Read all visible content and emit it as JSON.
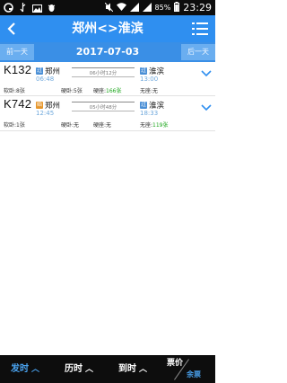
{
  "status_bar": {
    "battery": "85%",
    "time": "23:29"
  },
  "header": {
    "title": "郑州<>淮滨"
  },
  "date_bar": {
    "prev_label": "前一天",
    "date": "2017-07-03",
    "next_label": "后一天"
  },
  "trains": [
    {
      "number": "K132",
      "from_tag": "过",
      "from_station": "郑州",
      "depart_time": "06:48",
      "duration": "06小时12分",
      "to_tag": "过",
      "to_station": "淮滨",
      "arrive_time": "13:00",
      "seat_soft_sleeper": "软卧:8张",
      "seat_hard_sleeper": "硬卧:5张",
      "seat_hard_seat_label": "硬座:",
      "seat_hard_seat_count": "166张",
      "seat_no_seat": "无座:无"
    },
    {
      "number": "K742",
      "from_tag": "始",
      "from_station": "郑州",
      "depart_time": "12:45",
      "duration": "05小时48分",
      "to_tag": "过",
      "to_station": "淮滨",
      "arrive_time": "18:33",
      "seat_soft_sleeper": "软卧:1张",
      "seat_hard_sleeper": "硬卧:无",
      "seat_hard_seat_label": "硬座:无",
      "seat_hard_seat_count": "",
      "seat_no_seat_label": "无座:",
      "seat_no_seat_count": "119张"
    }
  ],
  "bottom_bar": {
    "depart_label": "发时",
    "duration_label": "历时",
    "arrive_label": "到时",
    "price_label": "票价",
    "remaining_label": "余票"
  },
  "colors": {
    "header_bg": "#2f8ff0",
    "date_bar_bg": "#3a8fe6",
    "active_sort": "#4aa3f0",
    "seat_available": "#1aa51a",
    "time_text": "#6fa8dc"
  }
}
